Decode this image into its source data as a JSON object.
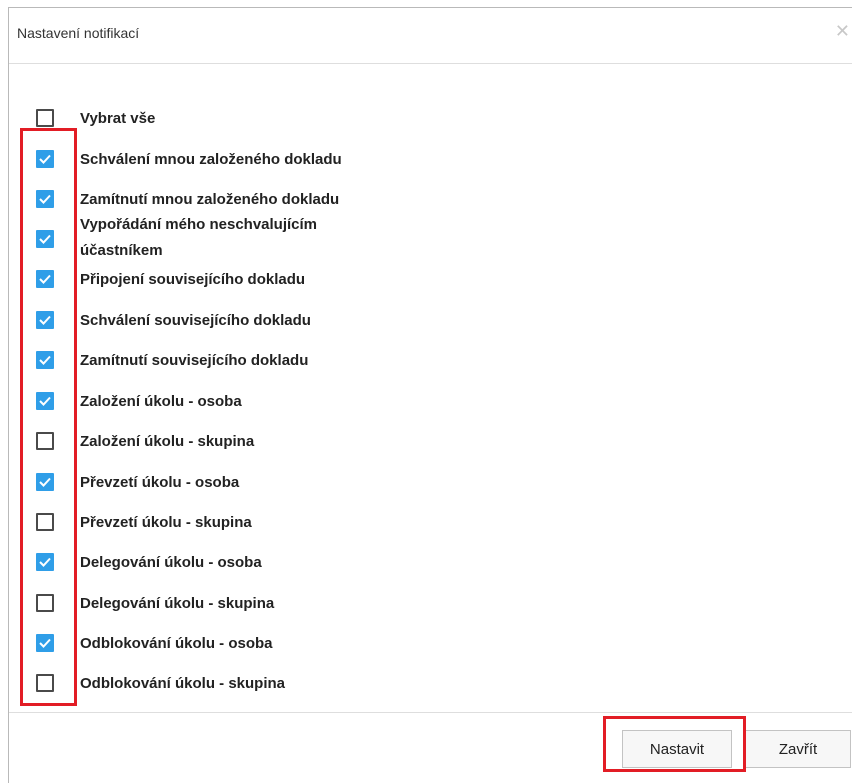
{
  "dialog": {
    "title": "Nastavení notifikací",
    "close_icon": "close-icon"
  },
  "options": [
    {
      "label": "Vybrat vše",
      "checked": false
    },
    {
      "label": "Schválení mnou založeného dokladu",
      "checked": true
    },
    {
      "label": "Zamítnutí mnou založeného dokladu",
      "checked": true
    },
    {
      "label": "Vypořádání mého neschvalujícím",
      "label2": "účastníkem",
      "checked": true
    },
    {
      "label": "Připojení souvisejícího dokladu",
      "checked": true
    },
    {
      "label": "Schválení souvisejícího dokladu",
      "checked": true
    },
    {
      "label": "Zamítnutí souvisejícího dokladu",
      "checked": true
    },
    {
      "label": "Založení úkolu - osoba",
      "checked": true
    },
    {
      "label": "Založení úkolu - skupina",
      "checked": false
    },
    {
      "label": "Převzetí úkolu - osoba",
      "checked": true
    },
    {
      "label": "Převzetí úkolu - skupina",
      "checked": false
    },
    {
      "label": "Delegování úkolu - osoba",
      "checked": true
    },
    {
      "label": "Delegování úkolu - skupina",
      "checked": false
    },
    {
      "label": "Odblokování úkolu - osoba",
      "checked": true
    },
    {
      "label": "Odblokování úkolu - skupina",
      "checked": false
    }
  ],
  "footer": {
    "set_label": "Nastavit",
    "close_label": "Zavřít"
  },
  "colors": {
    "checkbox_checked": "#2f9ee8",
    "highlight": "#e21d25"
  }
}
